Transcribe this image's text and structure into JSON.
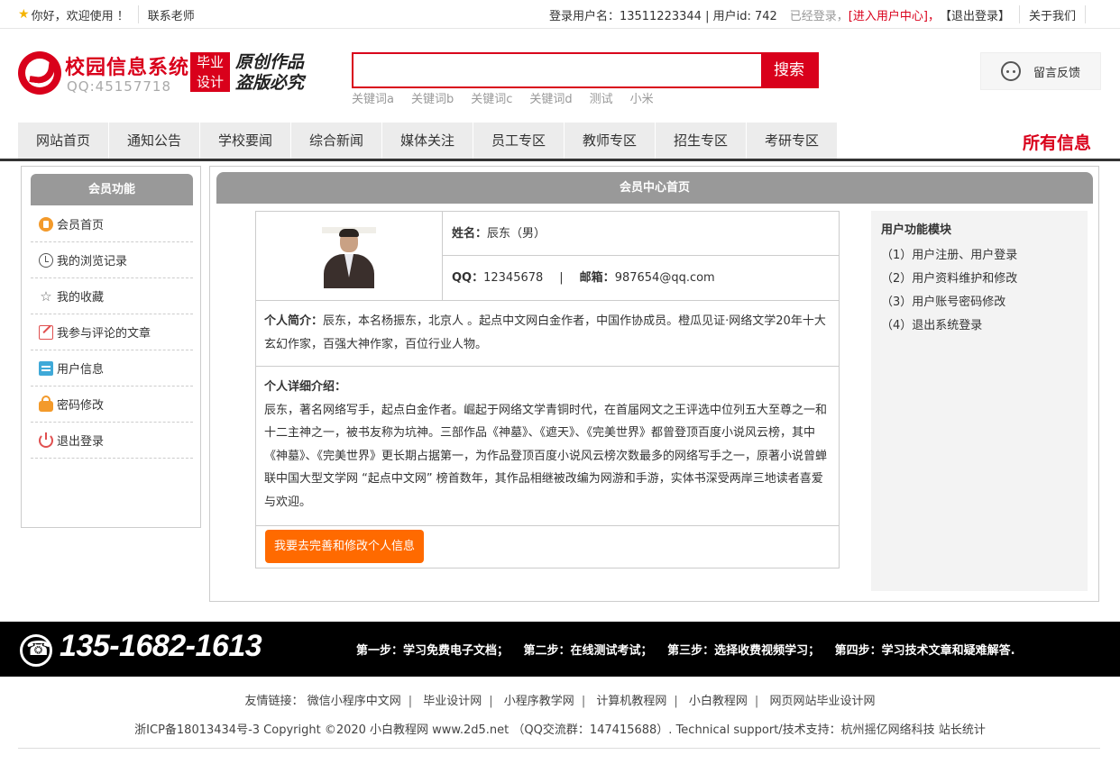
{
  "topbar": {
    "welcome": "你好，欢迎使用 ！",
    "contact_teacher": "联系老师",
    "login_info": "登录用户名：13511223344 | 用户id: 742",
    "logged_in": "已经登录，",
    "user_center": "[进入用户中心]",
    "comma": "，",
    "logout": "【退出登录】",
    "about": "关于我们"
  },
  "header": {
    "title": "校园信息系统",
    "qq": "QQ:45157718",
    "badge_line1": "毕业",
    "badge_line2": "设计",
    "slogan_line1": "原创作品",
    "slogan_line2": "盗版必究",
    "search_value": "",
    "search_button": "搜索",
    "keywords": [
      "关键词a",
      "关键词b",
      "关键词c",
      "关键词d",
      "测试",
      "小米"
    ],
    "feedback": "留言反馈"
  },
  "nav": {
    "items": [
      "网站首页",
      "通知公告",
      "学校要闻",
      "综合新闻",
      "媒体关注",
      "员工专区",
      "教师专区",
      "招生专区",
      "考研专区"
    ],
    "all_info": "所有信息"
  },
  "sidebar": {
    "title": "会员功能",
    "items": [
      {
        "label": "会员首页",
        "icon": "home-icon"
      },
      {
        "label": "我的浏览记录",
        "icon": "history-icon"
      },
      {
        "label": "我的收藏",
        "icon": "star-icon"
      },
      {
        "label": "我参与评论的文章",
        "icon": "edit-icon"
      },
      {
        "label": "用户信息",
        "icon": "clipboard-icon"
      },
      {
        "label": "密码修改",
        "icon": "lock-icon"
      },
      {
        "label": "退出登录",
        "icon": "power-icon"
      }
    ]
  },
  "main": {
    "title": "会员中心首页",
    "name_label": "姓名：",
    "name_value": "辰东（男）",
    "qq_label": "QQ：",
    "qq_value": "12345678",
    "pipe": "|",
    "email_label": "邮箱：",
    "email_value": "987654@qq.com",
    "intro_label": "个人简介：",
    "intro_text": "辰东，本名杨振东，北京人 。起点中文网白金作者，中国作协成员。橙瓜见证·网络文学20年十大玄幻作家，百强大神作家，百位行业人物。",
    "detail_label": "个人详细介绍：",
    "detail_text": "辰东，著名网络写手，起点白金作者。崛起于网络文学青铜时代，在首届网文之王评选中位列五大至尊之一和十二主神之一，被书友称为坑神。三部作品《神墓》、《遮天》、《完美世界》都曾登顶百度小说风云榜，其中《神墓》、《完美世界》更长期占据第一，为作品登顶百度小说风云榜次数最多的网络写手之一，原著小说曾蝉联中国大型文学网 “起点中文网” 榜首数年，其作品相继被改编为网游和手游，实体书深受两岸三地读者喜爱与欢迎。",
    "edit_button": "我要去完善和修改个人信息"
  },
  "module": {
    "title": "用户功能模块",
    "items": [
      "（1）用户注册、用户登录",
      "（2）用户资料维护和修改",
      "（3）用户账号密码修改",
      "（4）退出系统登录"
    ]
  },
  "footer": {
    "phone": "135-1682-1613",
    "steps": [
      "第一步：学习免费电子文档；",
      "第二步：在线测试考试；",
      "第三步：选择收费视频学习；",
      "第四步：学习技术文章和疑难解答."
    ],
    "links_label": "友情链接：",
    "links": [
      "微信小程序中文网",
      "毕业设计网",
      "小程序教学网",
      "计算机教程网",
      "小白教程网",
      "网页网站毕业设计网"
    ],
    "link_sep": "|",
    "copyright": "浙ICP备18013434号-3 Copyright ©2020 小白教程网 www.2d5.net （QQ交流群：147415688）. Technical support/技术支持：杭州摇亿网络科技 站长统计"
  },
  "colors": {
    "brand_red": "#d9001b",
    "button_orange": "#ff6a00",
    "header_gray": "#999999"
  }
}
